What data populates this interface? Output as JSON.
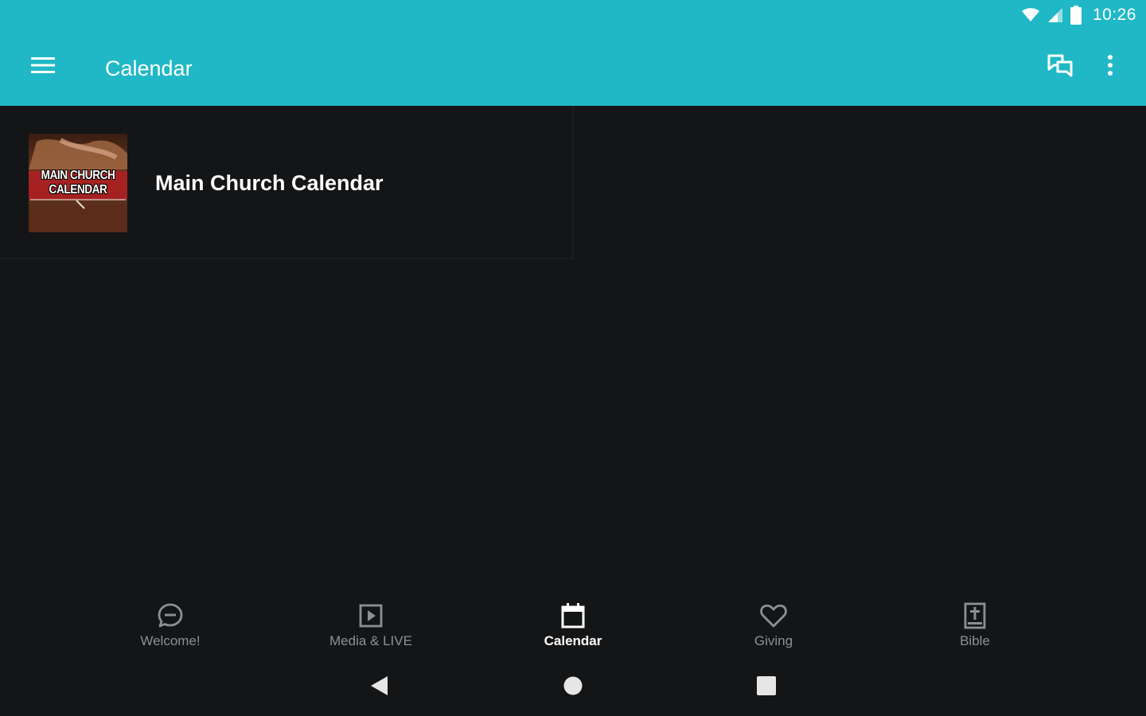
{
  "status_bar": {
    "time": "10:26",
    "icons": [
      "wifi-icon",
      "cell-signal-icon",
      "battery-icon"
    ]
  },
  "app_bar": {
    "title": "Calendar",
    "left_icon": "hamburger-menu-icon",
    "right_icons": [
      "chat-icon",
      "more-vert-icon"
    ]
  },
  "calendar_list": [
    {
      "title": "Main Church Calendar",
      "thumbnail_text": [
        "MAIN CHURCH",
        "CALENDAR"
      ]
    }
  ],
  "bottom_nav": {
    "items": [
      {
        "label": "Welcome!",
        "icon": "chat-bubble-icon",
        "active": false
      },
      {
        "label": "Media & LIVE",
        "icon": "play-box-icon",
        "active": false
      },
      {
        "label": "Calendar",
        "icon": "calendar-icon",
        "active": true
      },
      {
        "label": "Giving",
        "icon": "heart-icon",
        "active": false
      },
      {
        "label": "Bible",
        "icon": "bible-icon",
        "active": false
      }
    ]
  },
  "system_nav": {
    "buttons": [
      "back-icon",
      "home-icon",
      "recents-icon"
    ]
  },
  "colors": {
    "accent": "#20b8c6",
    "background": "#141517",
    "inactive_text": "#8e8f92",
    "active_text": "#ffffff"
  }
}
